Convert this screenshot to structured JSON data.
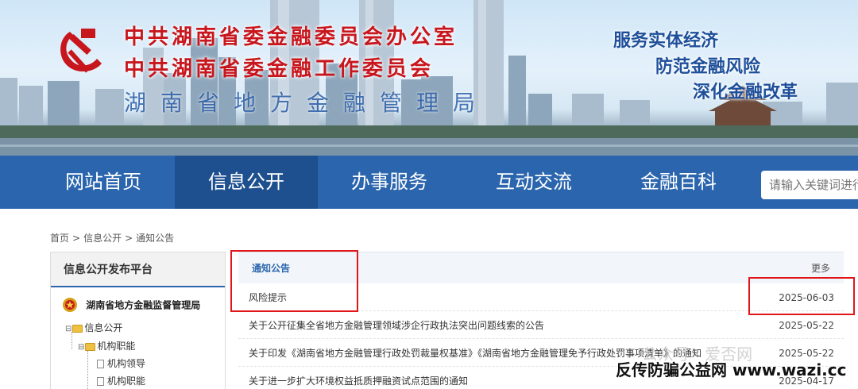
{
  "header": {
    "title_line_1": "中共湖南省委金融委员会办公室",
    "title_line_2": "中共湖南省委金融工作委员会",
    "title_line_3": "湖南省地方金融管理局",
    "slogans": [
      "服务实体经济",
      "防范金融风险",
      "深化金融改革"
    ],
    "emblem_icon": "party-emblem-icon",
    "colors": {
      "title_red": "#c8161d",
      "slogan_blue": "#1e4f9a"
    }
  },
  "nav": {
    "items": [
      {
        "label": "网站首页"
      },
      {
        "label": "信息公开"
      },
      {
        "label": "办事服务"
      },
      {
        "label": "互动交流"
      },
      {
        "label": "金融百科"
      }
    ],
    "active": "信息公开",
    "search_placeholder": "请输入关键词进行",
    "colors": {
      "bar": "#2a65ad",
      "active": "#1e4f8e"
    }
  },
  "breadcrumb": [
    "首页",
    "信息公开",
    "通知公告"
  ],
  "sidebar": {
    "title": "信息公开发布平台",
    "agency": "湖南省地方金融监督管理局",
    "tree": [
      "信息公开",
      "机构职能",
      "机构领导",
      "机构职能"
    ]
  },
  "notices": {
    "title": "通知公告",
    "more": "更多",
    "items": [
      {
        "title": "风险提示",
        "date": "2025-06-03"
      },
      {
        "title": "关于公开征集全省地方金融管理领域涉企行政执法突出问题线索的公告",
        "date": "2025-05-22"
      },
      {
        "title": "关于印发《湖南省地方金融管理行政处罚裁量权基准》《湖南省地方金融管理免予行政处罚事项清单》的通知",
        "date": "2025-05-22"
      },
      {
        "title": "关于进一步扩大环境权益抵质押融资试点范围的通知",
        "date": "2025-04-17"
      }
    ]
  },
  "watermark": {
    "faint": "公众号 · 爱否网",
    "strong": "反传防骗公益网 www.wazi.cc"
  }
}
